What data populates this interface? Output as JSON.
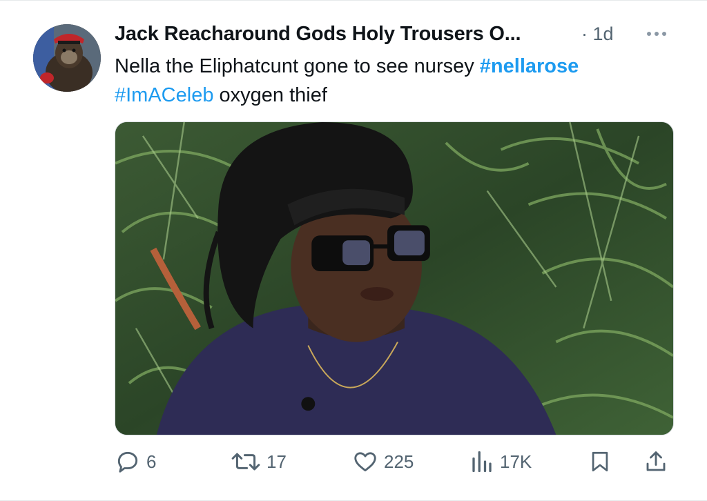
{
  "tweet": {
    "author": {
      "display_name": "Jack Reacharound Gods Holy Trousers O...",
      "separator": "·",
      "time": "1d"
    },
    "text": {
      "part1": "Nella the Eliphatcunt gone to see nursey ",
      "hashtag1": "#nellarose",
      "hashtag2": "#ImACeleb",
      "part2": " oxygen thief"
    },
    "actions": {
      "reply_count": "6",
      "retweet_count": "17",
      "like_count": "225",
      "views_count": "17K"
    },
    "icons": {
      "reply": "reply-icon",
      "retweet": "retweet-icon",
      "like": "heart-icon",
      "views": "views-chart-icon",
      "bookmark": "bookmark-icon",
      "share": "share-icon",
      "more": "more-dots-icon"
    },
    "colors": {
      "hashtag": "#1d9bf0",
      "muted": "#536471",
      "text": "#0f1419"
    }
  }
}
